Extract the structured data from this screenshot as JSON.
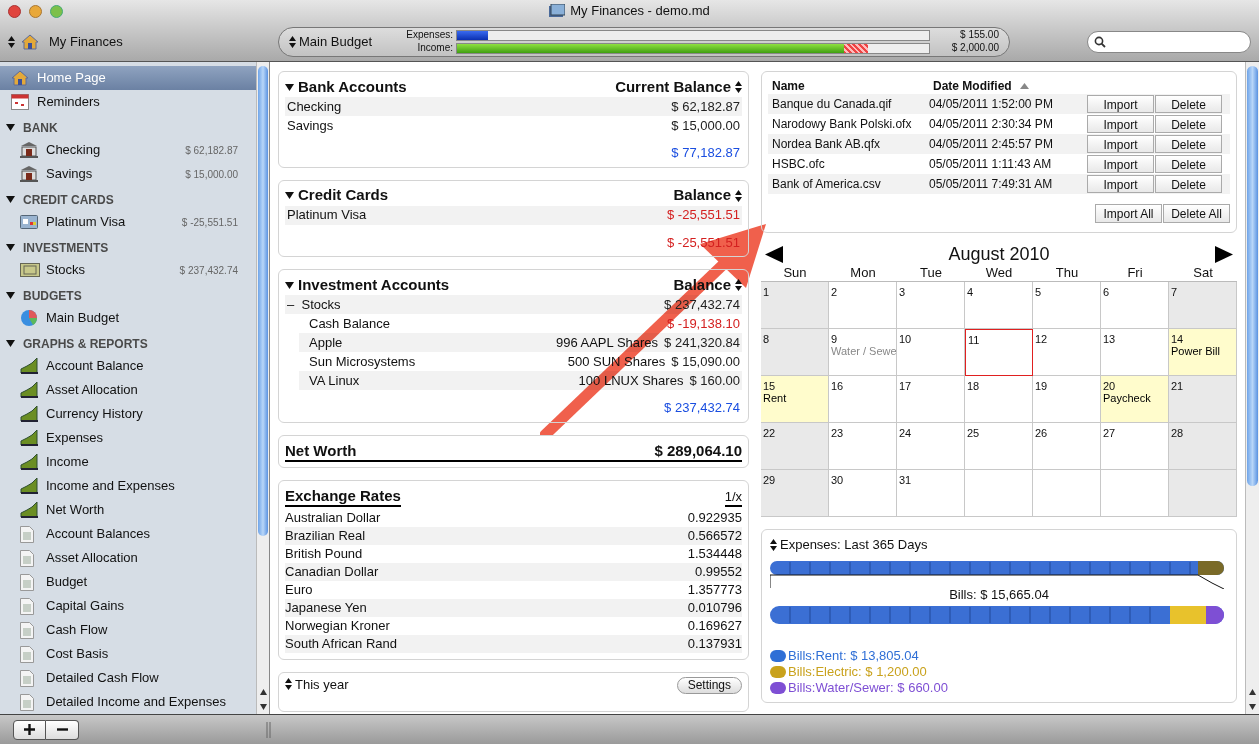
{
  "window": {
    "title": "My Finances - demo.md"
  },
  "toolbar": {
    "document": "My Finances",
    "budget": {
      "name": "Main Budget",
      "rows": [
        {
          "label": "Expenses:",
          "level": 0.065,
          "over_budget": false,
          "kind": "expense",
          "amount": "$ 155.00"
        },
        {
          "label": "Income:",
          "level": 0.82,
          "over_budget": true,
          "kind": "income",
          "amount": "$ 2,000.00"
        }
      ]
    }
  },
  "sidebar": {
    "items": [
      {
        "label": "Home Page",
        "kind": "home",
        "selected": true
      },
      {
        "label": "Reminders",
        "kind": "calendar",
        "selected": false
      }
    ],
    "sections": [
      {
        "title": "BANK",
        "expanded": true,
        "children": [
          {
            "label": "Checking",
            "kind": "bank",
            "amount": "$ 62,182.87"
          },
          {
            "label": "Savings",
            "kind": "bank",
            "amount": "$ 15,000.00"
          }
        ]
      },
      {
        "title": "CREDIT CARDS",
        "expanded": true,
        "children": [
          {
            "label": "Platinum Visa",
            "kind": "card",
            "amount": "$ -25,551.51"
          }
        ]
      },
      {
        "title": "INVESTMENTS",
        "expanded": true,
        "children": [
          {
            "label": "Stocks",
            "kind": "stock",
            "amount": "$ 237,432.74"
          }
        ]
      },
      {
        "title": "BUDGETS",
        "expanded": true,
        "children": [
          {
            "label": "Main Budget",
            "kind": "pie"
          }
        ]
      },
      {
        "title": "GRAPHS & REPORTS",
        "expanded": true,
        "children": [
          {
            "label": "Account Balance",
            "kind": "graph"
          },
          {
            "label": "Asset Allocation",
            "kind": "graph"
          },
          {
            "label": "Currency History",
            "kind": "graph"
          },
          {
            "label": "Expenses",
            "kind": "graph"
          },
          {
            "label": "Income",
            "kind": "graph"
          },
          {
            "label": "Income and Expenses",
            "kind": "graph"
          },
          {
            "label": "Net Worth",
            "kind": "graph"
          },
          {
            "label": "Account Balances",
            "kind": "report"
          },
          {
            "label": "Asset Allocation",
            "kind": "report"
          },
          {
            "label": "Budget",
            "kind": "report"
          },
          {
            "label": "Capital Gains",
            "kind": "report"
          },
          {
            "label": "Cash Flow",
            "kind": "report"
          },
          {
            "label": "Cost Basis",
            "kind": "report"
          },
          {
            "label": "Detailed Cash Flow",
            "kind": "report"
          },
          {
            "label": "Detailed Income and Expenses",
            "kind": "report"
          }
        ]
      }
    ]
  },
  "accounts": [
    {
      "title": "Bank Accounts",
      "column": "Current Balance",
      "expanded": true,
      "rows": [
        {
          "name": "Checking",
          "value": "$ 62,182.87",
          "negative": false
        },
        {
          "name": "Savings",
          "value": "$ 15,000.00",
          "negative": false
        }
      ],
      "total": "$ 77,182.87",
      "total_negative": false
    },
    {
      "title": "Credit Cards",
      "column": "Balance",
      "expanded": true,
      "rows": [
        {
          "name": "Platinum Visa",
          "value": "$ -25,551.51",
          "negative": true
        }
      ],
      "total": "$ -25,551.51",
      "total_negative": true
    },
    {
      "title": "Investment Accounts",
      "column": "Balance",
      "expanded": true,
      "rows": [
        {
          "name": "Stocks",
          "value": "$ 237,432.74",
          "negative": false,
          "toggle": "–",
          "children": [
            {
              "name": "Cash Balance",
              "value": "$ -19,138.10",
              "negative": true
            },
            {
              "name": "Apple",
              "shares": "996 AAPL Shares",
              "value": "$ 241,320.84",
              "negative": false
            },
            {
              "name": "Sun Microsystems",
              "shares": "500 SUN Shares",
              "value": "$ 15,090.00",
              "negative": false
            },
            {
              "name": "VA Linux",
              "shares": "100 LNUX Shares",
              "value": "$ 160.00",
              "negative": false
            }
          ]
        }
      ],
      "total": "$ 237,432.74",
      "total_negative": false
    }
  ],
  "net_worth": {
    "label": "Net Worth",
    "value": "$ 289,064.10"
  },
  "exchange_rates": {
    "title": "Exchange Rates",
    "toggle": "1/x",
    "rows": [
      {
        "name": "Australian Dollar",
        "rate": "0.922935"
      },
      {
        "name": "Brazilian Real",
        "rate": "0.566572"
      },
      {
        "name": "British Pound",
        "rate": "1.534448"
      },
      {
        "name": "Canadian Dollar",
        "rate": "0.99552"
      },
      {
        "name": "Euro",
        "rate": "1.357773"
      },
      {
        "name": "Japanese Yen",
        "rate": "0.010796"
      },
      {
        "name": "Norwegian Kroner",
        "rate": "0.169627"
      },
      {
        "name": "South African Rand",
        "rate": "0.137931"
      }
    ]
  },
  "period_panel": {
    "period": "This year",
    "button": "Settings"
  },
  "imports": {
    "columns": [
      "Name",
      "Date Modified"
    ],
    "rows": [
      {
        "name": "Banque du Canada.qif",
        "date": "04/05/2011 1:52:00 PM",
        "buttons": [
          "Import",
          "Delete"
        ]
      },
      {
        "name": "Narodowy Bank Polski.ofx",
        "date": "04/05/2011 2:30:34 PM",
        "buttons": [
          "Import",
          "Delete"
        ]
      },
      {
        "name": "Nordea Bank AB.qfx",
        "date": "04/05/2011 2:45:57 PM",
        "buttons": [
          "Import",
          "Delete"
        ]
      },
      {
        "name": "HSBC.ofc",
        "date": "05/05/2011 1:11:43 AM",
        "buttons": [
          "Import",
          "Delete"
        ]
      },
      {
        "name": "Bank of America.csv",
        "date": "05/05/2011 7:49:31 AM",
        "buttons": [
          "Import",
          "Delete"
        ]
      }
    ],
    "buttons": [
      "Import All",
      "Delete All"
    ]
  },
  "calendar": {
    "title": "August 2010",
    "weekdays": [
      "Sun",
      "Mon",
      "Tue",
      "Wed",
      "Thu",
      "Fri",
      "Sat"
    ],
    "weeks": [
      [
        {
          "day": "1",
          "weekend": true
        },
        {
          "day": "2"
        },
        {
          "day": "3"
        },
        {
          "day": "4"
        },
        {
          "day": "5"
        },
        {
          "day": "6"
        },
        {
          "day": "7",
          "weekend": true
        }
      ],
      [
        {
          "day": "8",
          "weekend": true
        },
        {
          "day": "9",
          "event": "Water / Sewe",
          "muted": true
        },
        {
          "day": "10"
        },
        {
          "day": "11",
          "today": true
        },
        {
          "day": "12"
        },
        {
          "day": "13"
        },
        {
          "day": "14",
          "event": "Power Bill",
          "muted": false,
          "highlight": true
        }
      ],
      [
        {
          "day": "15",
          "event": "Rent",
          "muted": false,
          "highlight": true
        },
        {
          "day": "16"
        },
        {
          "day": "17"
        },
        {
          "day": "18"
        },
        {
          "day": "19"
        },
        {
          "day": "20",
          "event": "Paycheck",
          "muted": false,
          "highlight": true
        },
        {
          "day": "21",
          "weekend": true
        }
      ],
      [
        {
          "day": "22",
          "weekend": true
        },
        {
          "day": "23"
        },
        {
          "day": "24"
        },
        {
          "day": "25"
        },
        {
          "day": "26"
        },
        {
          "day": "27"
        },
        {
          "day": "28",
          "weekend": true
        }
      ],
      [
        {
          "day": "29",
          "weekend": true
        },
        {
          "day": "30"
        },
        {
          "day": "31"
        },
        {
          "kind": "blank"
        },
        {
          "kind": "blank"
        },
        {
          "kind": "blank"
        },
        {
          "kind": "blank",
          "weekend": true
        }
      ]
    ]
  },
  "expenses": {
    "title": "Expenses: Last 365 Days",
    "detail": "Bills: $ 15,665.04",
    "legend": [
      {
        "label": "Bills:Rent: $ 13,805.04",
        "color": "#2f6fd6"
      },
      {
        "label": "Bills:Electric: $ 1,200.00",
        "color": "#c9a21c"
      },
      {
        "label": "Bills:Water/Sewer: $ 660.00",
        "color": "#7e4fd4"
      }
    ]
  }
}
